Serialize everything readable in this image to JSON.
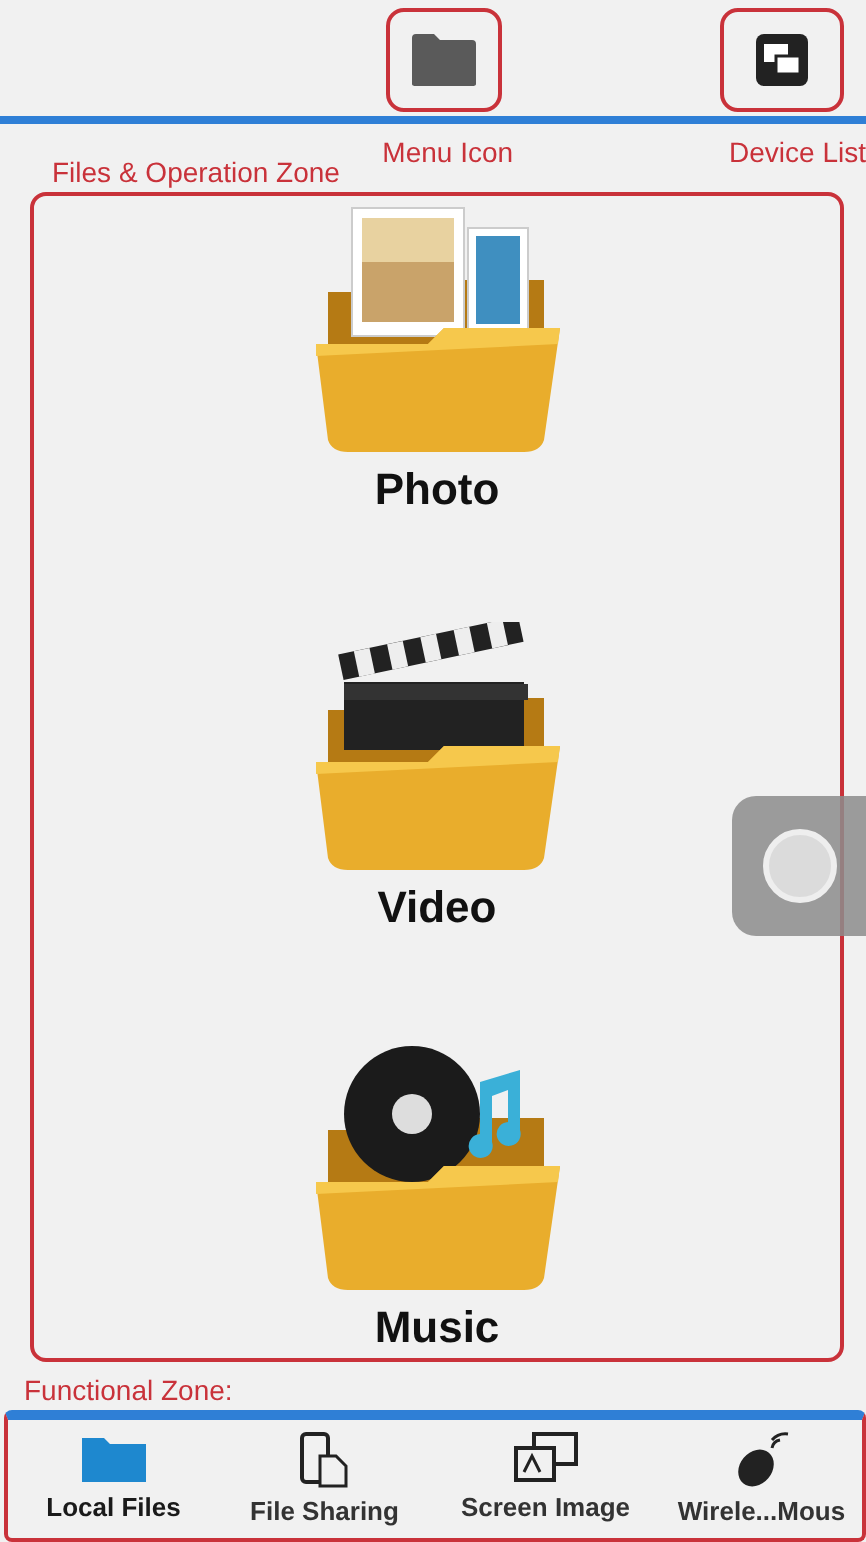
{
  "top_bar": {
    "annotations": [
      {
        "kind": "menu",
        "label": "Menu Icon"
      },
      {
        "kind": "devices",
        "label": "Device List"
      }
    ]
  },
  "files_zone": {
    "annotation": "Files & Operation Zone",
    "folders": [
      {
        "kind": "photo",
        "label": "Photo"
      },
      {
        "kind": "video",
        "label": "Video"
      },
      {
        "kind": "music",
        "label": "Music"
      }
    ]
  },
  "functional_zone": {
    "annotation": "Functional Zone:",
    "tabs": [
      {
        "kind": "local",
        "label": "Local Files",
        "selected": true
      },
      {
        "kind": "sharing",
        "label": "File Sharing",
        "selected": false
      },
      {
        "kind": "screen",
        "label": "Screen Image",
        "selected": false
      },
      {
        "kind": "mouse",
        "label": "Wirele...Mous",
        "selected": false
      }
    ]
  }
}
